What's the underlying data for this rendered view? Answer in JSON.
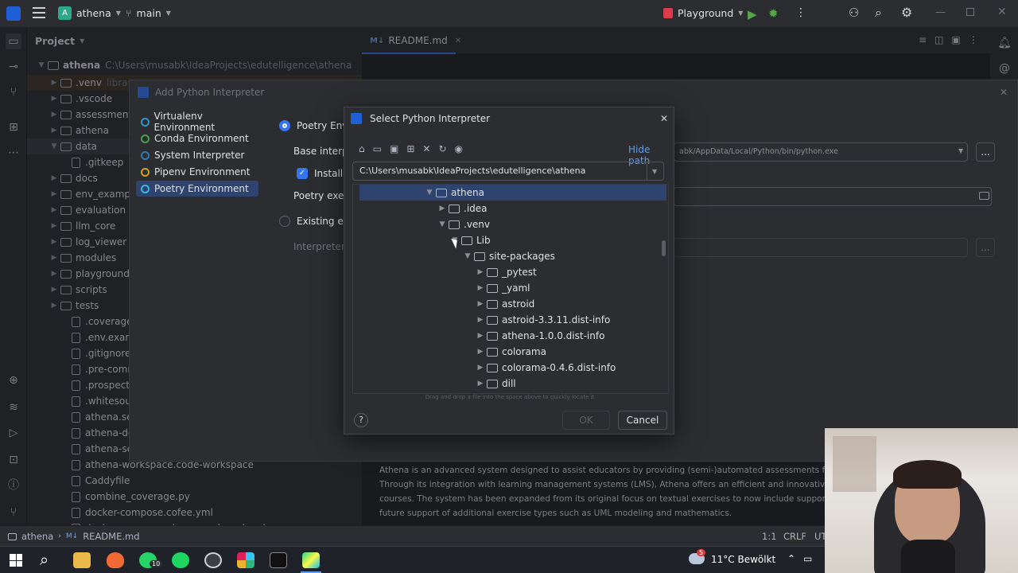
{
  "titlebar": {
    "project_badge": "A",
    "project": "athena",
    "branch": "main",
    "run_config": "Playground"
  },
  "project_panel": {
    "title": "Project",
    "root": {
      "name": "athena",
      "path": "C:\\Users\\musabk\\IdeaProjects\\edutelligence\\athena"
    },
    "items": [
      {
        "label": ".venv",
        "hint": "library"
      },
      {
        "label": ".vscode"
      },
      {
        "label": "assessment_"
      },
      {
        "label": "athena"
      },
      {
        "label": "data"
      },
      {
        "label": ".gitkeep"
      },
      {
        "label": "docs"
      },
      {
        "label": "env_example"
      },
      {
        "label": "evaluation"
      },
      {
        "label": "llm_core"
      },
      {
        "label": "log_viewer"
      },
      {
        "label": "modules"
      },
      {
        "label": "playground"
      },
      {
        "label": "scripts"
      },
      {
        "label": "tests"
      },
      {
        "label": ".coveragerc"
      },
      {
        "label": ".env.example"
      },
      {
        "label": ".gitignore"
      },
      {
        "label": ".pre-commit-"
      },
      {
        "label": ".prospector.y"
      },
      {
        "label": ".whitesource"
      },
      {
        "label": "athena.servic"
      },
      {
        "label": "athena-docke"
      },
      {
        "label": "athena-serve"
      },
      {
        "label": "athena-workspace.code-workspace"
      },
      {
        "label": "Caddyfile"
      },
      {
        "label": "combine_coverage.py"
      },
      {
        "label": "docker-compose.cofee.yml"
      },
      {
        "label": "docker-compose.playground.prod.yml"
      }
    ]
  },
  "editor": {
    "tab": "README.md",
    "readme": [
      "Athena is an advanced system designed to assist educators by providing (semi-)automated assessments for various",
      "Through its integration with learning management systems (LMS), Athena offers an efficient and innovative way to ev",
      "courses. The system has been expanded from its original focus on textual exercises to now include support for progra",
      "future support of additional exercise types such as UML modeling and mathematics."
    ]
  },
  "add_interpreter": {
    "title": "Add Python Interpreter",
    "env_types": [
      "Virtualenv Environment",
      "Conda Environment",
      "System Interpreter",
      "Pipenv Environment",
      "Poetry Environment"
    ],
    "radio_new": "Poetry Envi",
    "base_interp": "Base interp",
    "install": "Install p",
    "poetry_exec": "Poetry exec",
    "radio_existing": "Existing en",
    "interpreter": "Interpreter:",
    "python_path": "abk/AppData/Local/Python/bin/python.exe",
    "browse": "..."
  },
  "select_interpreter": {
    "title": "Select Python Interpreter",
    "hide_path": "Hide path",
    "path": "C:\\Users\\musabk\\IdeaProjects\\edutelligence\\athena",
    "tree": [
      {
        "label": "athena"
      },
      {
        "label": ".idea"
      },
      {
        "label": ".venv"
      },
      {
        "label": "Lib"
      },
      {
        "label": "site-packages"
      },
      {
        "label": "_pytest"
      },
      {
        "label": "_yaml"
      },
      {
        "label": "astroid"
      },
      {
        "label": "astroid-3.3.11.dist-info"
      },
      {
        "label": "athena-1.0.0.dist-info"
      },
      {
        "label": "colorama"
      },
      {
        "label": "colorama-0.4.6.dist-info"
      },
      {
        "label": "dill"
      }
    ],
    "hint": "Drag and drop a file into the space above to quickly locate it",
    "ok": "OK",
    "cancel": "Cancel",
    "help": "?"
  },
  "statusbar": {
    "crumb_project": "athena",
    "crumb_file": "README.md",
    "position": "1:1",
    "line_sep": "CRLF",
    "encoding": "UT"
  },
  "taskbar": {
    "weather": "11°C Bewölkt",
    "weather_badge": "5",
    "whatsapp_badge": "10"
  },
  "colors": {
    "accent": "#3574f0",
    "selection": "#2e436e",
    "panel": "#2b2d30",
    "editor": "#1e1f22"
  }
}
